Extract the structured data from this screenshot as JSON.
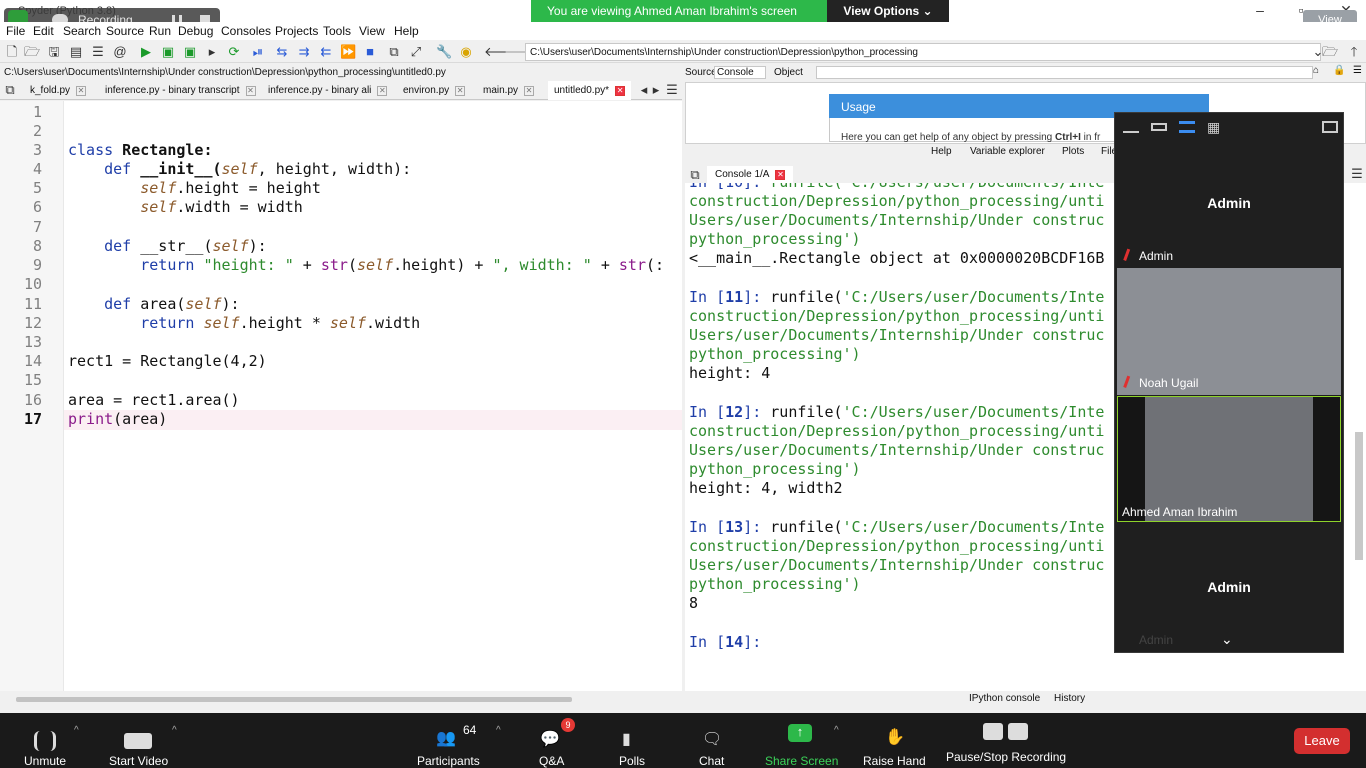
{
  "window": {
    "title": "Spyder (Python 3.8)",
    "recording_label": "Recording...",
    "share_banner": "You are viewing Ahmed Aman Ibrahim's screen",
    "view_options": "View Options",
    "view_button": "View"
  },
  "menu": [
    "File",
    "Edit",
    "Search",
    "Source",
    "Run",
    "Debug",
    "Consoles",
    "Projects",
    "Tools",
    "View",
    "Help"
  ],
  "toolbar": {
    "path": "C:\\Users\\user\\Documents\\Internship\\Under construction\\Depression\\python_processing"
  },
  "editor": {
    "file_path": "C:\\Users\\user\\Documents\\Internship\\Under construction\\Depression\\python_processing\\untitled0.py",
    "tabs": [
      "k_fold.py",
      "inference.py - binary transcript",
      "inference.py - binary ali",
      "environ.py",
      "main.py",
      "untitled0.py*"
    ],
    "line_numbers": [
      "1",
      "2",
      "3",
      "4",
      "5",
      "6",
      "7",
      "8",
      "9",
      "10",
      "11",
      "12",
      "13",
      "14",
      "15",
      "16",
      "17"
    ],
    "code": {
      "l3_kw": "class",
      "l3_name": " Rectangle:",
      "l4_kw": "    def",
      "l4_a": " __init__(",
      "l4_self": "self",
      "l4_b": ", height, width):",
      "l5_self": "        self",
      "l5_b": ".height = height",
      "l6_self": "        self",
      "l6_b": ".width = width",
      "l8_kw": "    def",
      "l8_a": " __str__(",
      "l8_self": "self",
      "l8_b": "):",
      "l9_kw": "        return",
      "l9_str1": " \"height: \"",
      "l9_plus": " + ",
      "l9_fn": "str",
      "l9_p": "(",
      "l9_self": "self",
      "l9_h": ".height) + ",
      "l9_str2": "\", width: \"",
      "l9_plus2": " + ",
      "l9_fn2": "str",
      "l9_tail": "(:",
      "l11_kw": "    def",
      "l11_a": " area(",
      "l11_self": "self",
      "l11_b": "):",
      "l12_kw": "        return",
      "l12_self1": " self",
      "l12_mid": ".height * ",
      "l12_self2": "self",
      "l12_end": ".width",
      "l14": "rect1 = Rectangle(4,2)",
      "l16": "area = rect1.area()",
      "l17_fn": "print",
      "l17_rest": "(area)"
    }
  },
  "help_pane": {
    "source_label": "Source",
    "source_value": "Console",
    "object_label": "Object",
    "usage_title": "Usage",
    "usage_text": "Here you can get help of any object by pressing",
    "usage_key": "Ctrl+I",
    "usage_tail": "in fr",
    "tabs": [
      "Help",
      "Variable explorer",
      "Plots",
      "File"
    ]
  },
  "console": {
    "tab": "Console 1/A",
    "lines": {
      "c0a": "In [10]: ",
      "c0b": "runfile('C:/Users/user/Documents/Inte",
      "c1": "construction/Depression/python_processing/unti",
      "c2": "Users/user/Documents/Internship/Under construc",
      "c3": "python_processing')",
      "c4": "<__main__.Rectangle object at 0x0000020BCDF16B",
      "c6a": "In [",
      "c6n": "11",
      "c6b": "]: ",
      "c6c": "runfile(",
      "c6d": "'C:/Users/user/Documents/Inte",
      "c7": "construction/Depression/python_processing/unti",
      "c8": "Users/user/Documents/Internship/Under construc",
      "c9": "python_processing')",
      "c10": "height: 4",
      "c12a": "In [",
      "c12n": "12",
      "c12b": "]: ",
      "c12c": "runfile(",
      "c12d": "'C:/Users/user/Documents/Inte",
      "c13": "construction/Depression/python_processing/unti",
      "c14": "Users/user/Documents/Internship/Under construc",
      "c15": "python_processing')",
      "c16": "height: 4, width2",
      "c18a": "In [",
      "c18n": "13",
      "c18b": "]: ",
      "c18c": "runfile(",
      "c18d": "'C:/Users/user/Documents/Inte",
      "c19": "construction/Depression/python_processing/unti",
      "c20": "Users/user/Documents/Internship/Under construc",
      "c21": "python_processing')",
      "c22": "8",
      "c24a": "In [",
      "c24n": "14",
      "c24b": "]:"
    },
    "bottom_tabs": [
      "IPython console",
      "History"
    ]
  },
  "zoom_panel": {
    "tiles": [
      {
        "big_name": "Admin",
        "caption": "Admin"
      },
      {
        "caption": "Noah Ugail"
      },
      {
        "caption": "Ahmed Aman Ibrahim"
      },
      {
        "big_name": "Admin",
        "caption": "Admin"
      }
    ]
  },
  "zoom_bar": {
    "unmute": "Unmute",
    "start_video": "Start Video",
    "participants": "Participants",
    "participants_count": "64",
    "qa": "Q&A",
    "qa_badge": "9",
    "polls": "Polls",
    "chat": "Chat",
    "share_screen": "Share Screen",
    "raise_hand": "Raise Hand",
    "pause_stop": "Pause/Stop Recording",
    "leave": "Leave",
    "accent_green": "#2db84a",
    "leave_red": "#d32f2f"
  }
}
